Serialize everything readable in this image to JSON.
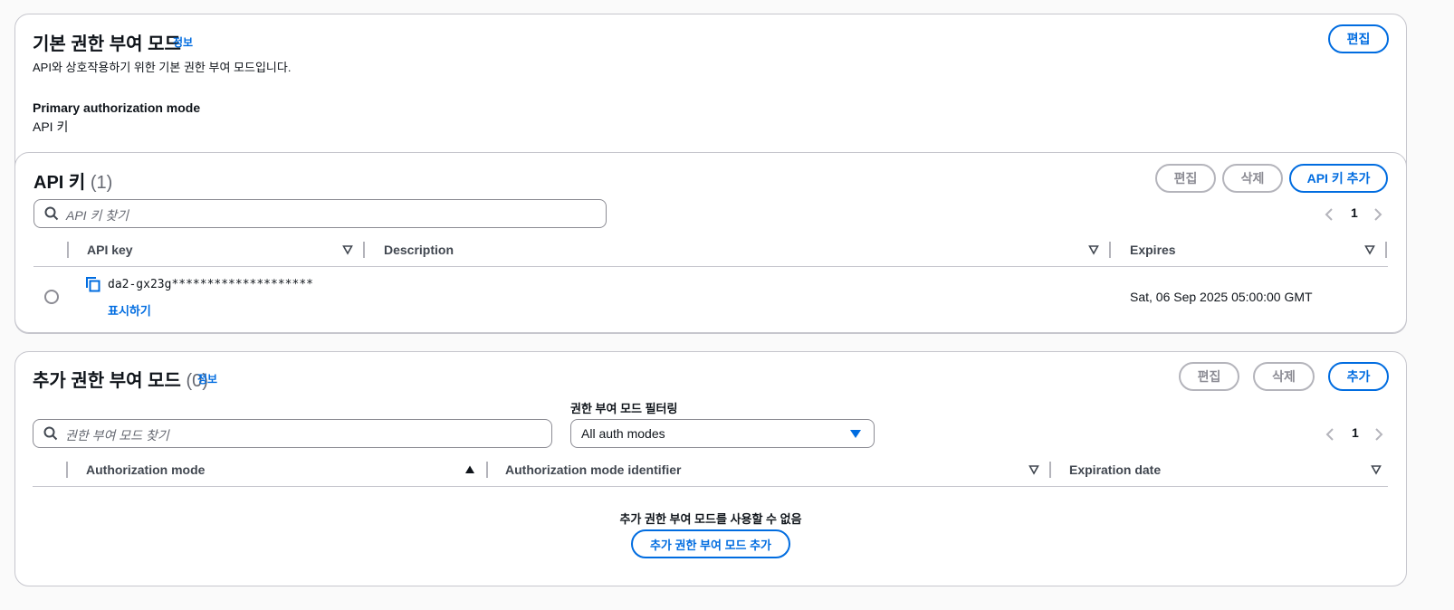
{
  "primary_section": {
    "title": "기본 권한 부여 모드",
    "info_label": "정보",
    "description": "API와 상호작용하기 위한 기본 권한 부여 모드입니다.",
    "edit_label": "편집",
    "field_label": "Primary authorization mode",
    "field_value": "API 키"
  },
  "api_keys": {
    "title": "API 키",
    "count": "(1)",
    "edit_label": "편집",
    "delete_label": "삭제",
    "add_label": "API 키 추가",
    "search_placeholder": "API 키 찾기",
    "page": "1",
    "columns": [
      "API key",
      "Description",
      "Expires"
    ],
    "rows": [
      {
        "key": "da2-gx23g********************",
        "show_label": "표시하기",
        "description": "",
        "expires": "Sat, 06 Sep 2025 05:00:00 GMT"
      }
    ]
  },
  "additional_modes": {
    "title": "추가 권한 부여 모드",
    "count": "(0)",
    "info_label": "정보",
    "edit_label": "편집",
    "delete_label": "삭제",
    "add_label": "추가",
    "search_placeholder": "권한 부여 모드 찾기",
    "filter_label": "권한 부여 모드 필터링",
    "filter_value": "All auth modes",
    "page": "1",
    "columns": [
      "Authorization mode",
      "Authorization mode identifier",
      "Expiration date"
    ],
    "empty_text": "추가 권한 부여 모드를 사용할 수 없음",
    "empty_button_label": "추가 권한 부여 모드 추가"
  },
  "colors": {
    "accent": "#006ce0",
    "disabled": "#b4b4bb",
    "border": "#c6c6cd",
    "background": "#fafafa"
  },
  "icons": [
    "search-icon",
    "copy-icon",
    "caret-down-icon",
    "sort-icon",
    "sort-ascending-icon",
    "chevron-left-icon",
    "chevron-right-icon"
  ]
}
